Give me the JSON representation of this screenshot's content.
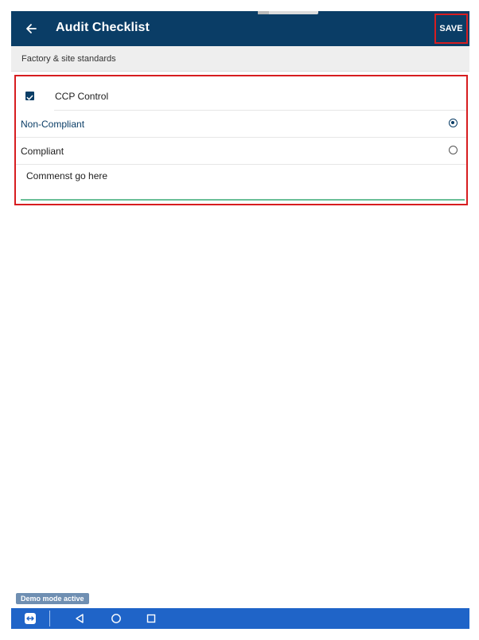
{
  "app_bar": {
    "title": "Audit Checklist",
    "save_label": "SAVE",
    "back_icon": "arrow-left-icon",
    "bg_color": "#0a3d66"
  },
  "section": {
    "title": "Factory & site standards"
  },
  "checklist_item": {
    "label": "CCP Control",
    "checked": true,
    "options": [
      {
        "label": "Non-Compliant",
        "selected": true
      },
      {
        "label": "Compliant",
        "selected": false
      }
    ],
    "comment": "Commenst go here"
  },
  "status": {
    "demo_badge": "Demo mode active"
  },
  "nav_bar": {
    "items": [
      "remote-control-icon",
      "back-triangle-icon",
      "home-circle-icon",
      "recents-square-icon"
    ],
    "bg_color": "#1f64c8"
  },
  "colors": {
    "highlight": "#d71d20",
    "selected_text": "#0a3d66",
    "comment_underline": "#6bbf98"
  }
}
